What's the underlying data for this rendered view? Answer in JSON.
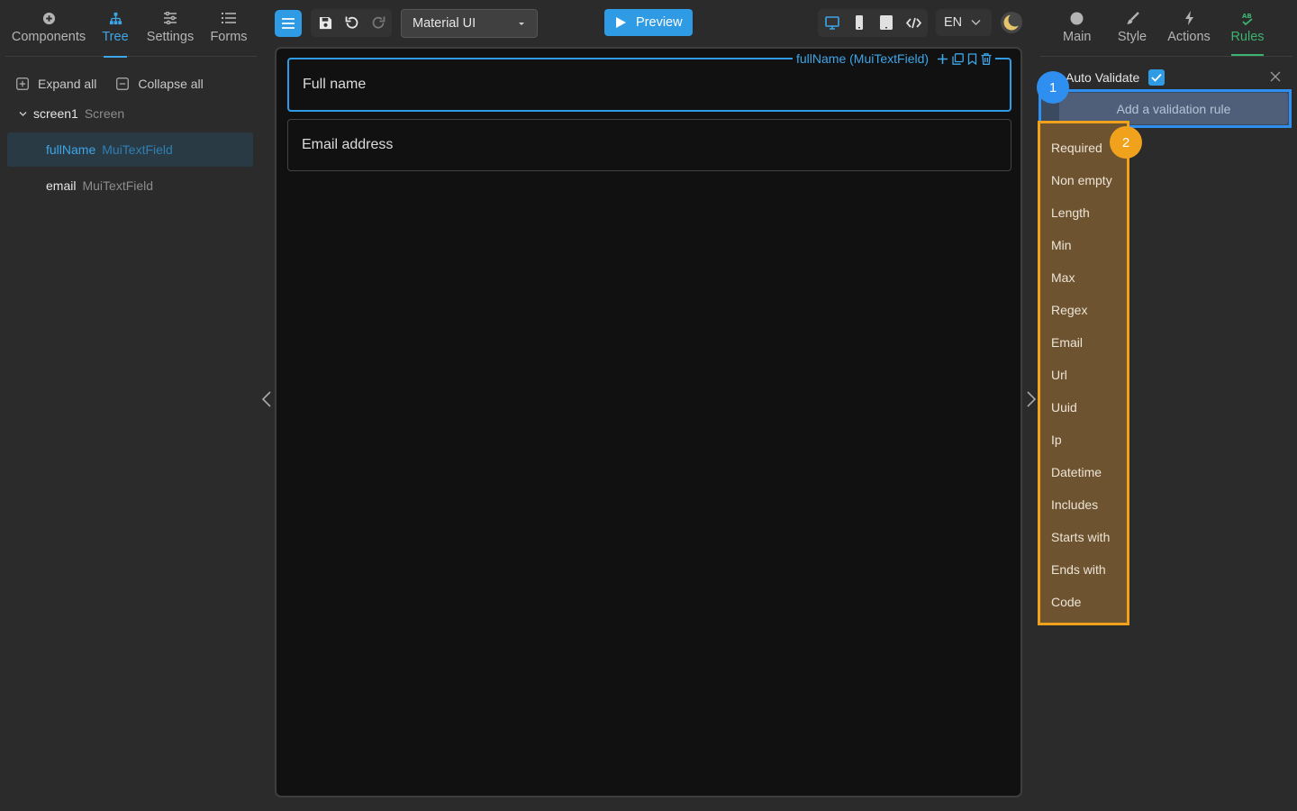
{
  "left_panel": {
    "tabs": [
      {
        "label": "Components",
        "icon": "plus-circle-icon"
      },
      {
        "label": "Tree",
        "icon": "tree-icon",
        "active": true
      },
      {
        "label": "Settings",
        "icon": "sliders-icon"
      },
      {
        "label": "Forms",
        "icon": "list-icon"
      }
    ],
    "expand_all": "Expand all",
    "collapse_all": "Collapse all",
    "tree": {
      "screen": {
        "name": "screen1",
        "type": "Screen"
      },
      "items": [
        {
          "name": "fullName",
          "type": "MuiTextField",
          "selected": true
        },
        {
          "name": "email",
          "type": "MuiTextField",
          "selected": false
        }
      ]
    }
  },
  "toolbar": {
    "library_select": "Material UI",
    "preview_label": "Preview",
    "language": "EN",
    "view_modes": [
      "desktop-icon",
      "mobile-icon",
      "tablet-icon",
      "code-icon"
    ]
  },
  "canvas": {
    "fields": [
      {
        "placeholder": "Full name"
      },
      {
        "placeholder": "Email address"
      }
    ],
    "selection_label": "fullName (MuiTextField)"
  },
  "right_panel": {
    "tabs": [
      {
        "label": "Main",
        "icon": "circle-icon"
      },
      {
        "label": "Style",
        "icon": "brush-icon"
      },
      {
        "label": "Actions",
        "icon": "bolt-icon"
      },
      {
        "label": "Rules",
        "icon": "ab-check-icon",
        "active": true
      }
    ],
    "auto_validate_label": "Auto Validate",
    "auto_validate_checked": true,
    "add_rule_placeholder": "Add a validation rule",
    "rules": [
      "Required",
      "Non empty",
      "Length",
      "Min",
      "Max",
      "Regex",
      "Email",
      "Url",
      "Uuid",
      "Ip",
      "Datetime",
      "Includes",
      "Starts with",
      "Ends with",
      "Code"
    ]
  },
  "annotations": {
    "badge_1": "1",
    "badge_2": "2"
  },
  "colors": {
    "accent": "#2f9be4",
    "rules_accent": "#3cb371",
    "highlight_blue": "#2f8ff0",
    "highlight_orange": "#f0a21c",
    "background": "#2b2b2b",
    "canvas": "#111111"
  }
}
